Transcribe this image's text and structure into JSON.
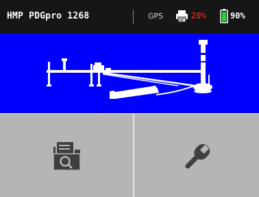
{
  "status_bar": {
    "device_name": "HMP PDGpro 1268",
    "gps_label": "GPS",
    "printer_battery": "20%",
    "device_battery": "90%",
    "icons": [
      "printer-icon",
      "battery-icon"
    ],
    "colors": {
      "background": "#161616",
      "printer_battery": "#e01b1b",
      "battery_fill": "#2ecc40"
    }
  },
  "banner": {
    "illustration": "pressure-gauge-test-rig",
    "background": "#0000ff"
  },
  "tiles": [
    {
      "icon": "document-search-icon"
    },
    {
      "icon": "wrench-icon"
    }
  ]
}
